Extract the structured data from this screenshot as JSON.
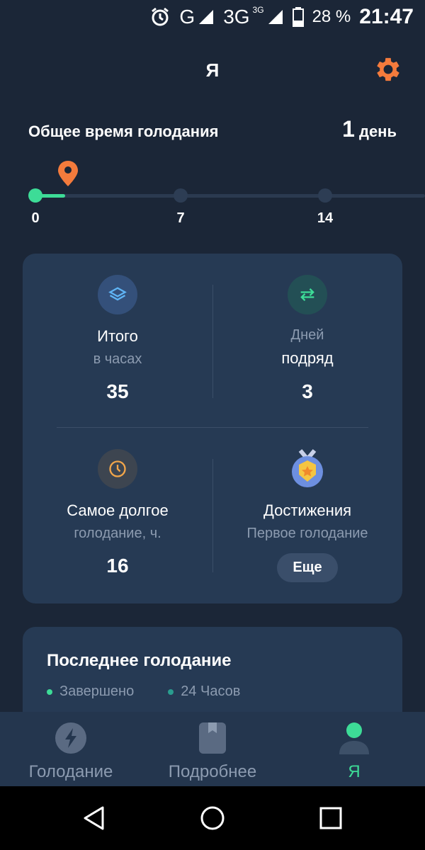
{
  "status_bar": {
    "network_g": "G",
    "network_3g": "3G",
    "network_3g_sup": "3G",
    "battery_pct": "28 %",
    "time": "21:47"
  },
  "header": {
    "title": "Я"
  },
  "total": {
    "label": "Общее время голодания",
    "value_num": "1",
    "value_unit": "день"
  },
  "track": {
    "labels": [
      "0",
      "7",
      "14"
    ],
    "progress_fraction": 0.1,
    "colors": {
      "active": "#3ddc97",
      "pin": "#f47b3c"
    }
  },
  "stats": {
    "total_hours": {
      "label_main": "Итого",
      "label_sub": "в часах",
      "value": "35",
      "icon": "layers-icon"
    },
    "streak": {
      "label_sub": "Дней",
      "label_main": "подряд",
      "value": "3",
      "icon": "repeat-icon"
    },
    "longest": {
      "label_main": "Самое долгое",
      "label_sub": "голодание, ч.",
      "value": "16",
      "icon": "clock-icon"
    },
    "achievements": {
      "label_main": "Достижения",
      "label_sub": "Первое голодание",
      "button": "Еще",
      "icon": "medal-icon"
    }
  },
  "last_fast": {
    "title": "Последнее голодание",
    "status": "Завершено",
    "duration": "24 Часов"
  },
  "bottom_nav": {
    "items": [
      {
        "label": "Голодание",
        "icon": "bolt-icon"
      },
      {
        "label": "Подробнее",
        "icon": "bookmark-icon"
      },
      {
        "label": "Я",
        "icon": "profile-icon",
        "active": true
      }
    ]
  },
  "colors": {
    "accent_green": "#3ddc97",
    "accent_orange": "#f47b3c",
    "bg": "#1b2637",
    "card": "#263a54"
  }
}
